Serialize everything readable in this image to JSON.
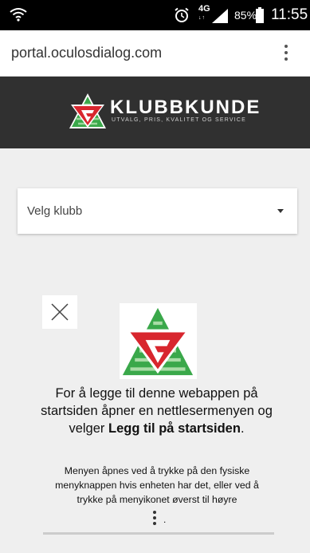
{
  "status_bar": {
    "network_type": "4G",
    "network_sub": "↓↑",
    "battery_percent": "85%",
    "time": "11:55",
    "icons": [
      "wifi-icon",
      "alarm-icon",
      "signal-icon",
      "battery-icon"
    ]
  },
  "browser": {
    "url": "portal.oculosdialog.com",
    "menu_icon": "overflow-menu-icon"
  },
  "header": {
    "brand_name": "KLUBBKUNDE",
    "tagline": "UTVALG, PRIS, KVALITET OG SERVICE",
    "colors": {
      "background": "#303030",
      "logo_red": "#d8262e",
      "logo_green": "#3aa84a"
    }
  },
  "club_select": {
    "selected": "Velg klubb"
  },
  "install_prompt": {
    "close_icon": "close-icon",
    "main_text_before": "For å legge til denne webappen på startsiden åpner en nettlesermenyen og velger ",
    "main_text_bold": "Legg til på startsiden",
    "main_text_after": ".",
    "sub_text": "Menyen åpnes ved å trykke på den fysiske menyknappen hvis enheten har det, eller ved å trykke på menyikonet øverst til høyre",
    "sub_text_end": "."
  }
}
